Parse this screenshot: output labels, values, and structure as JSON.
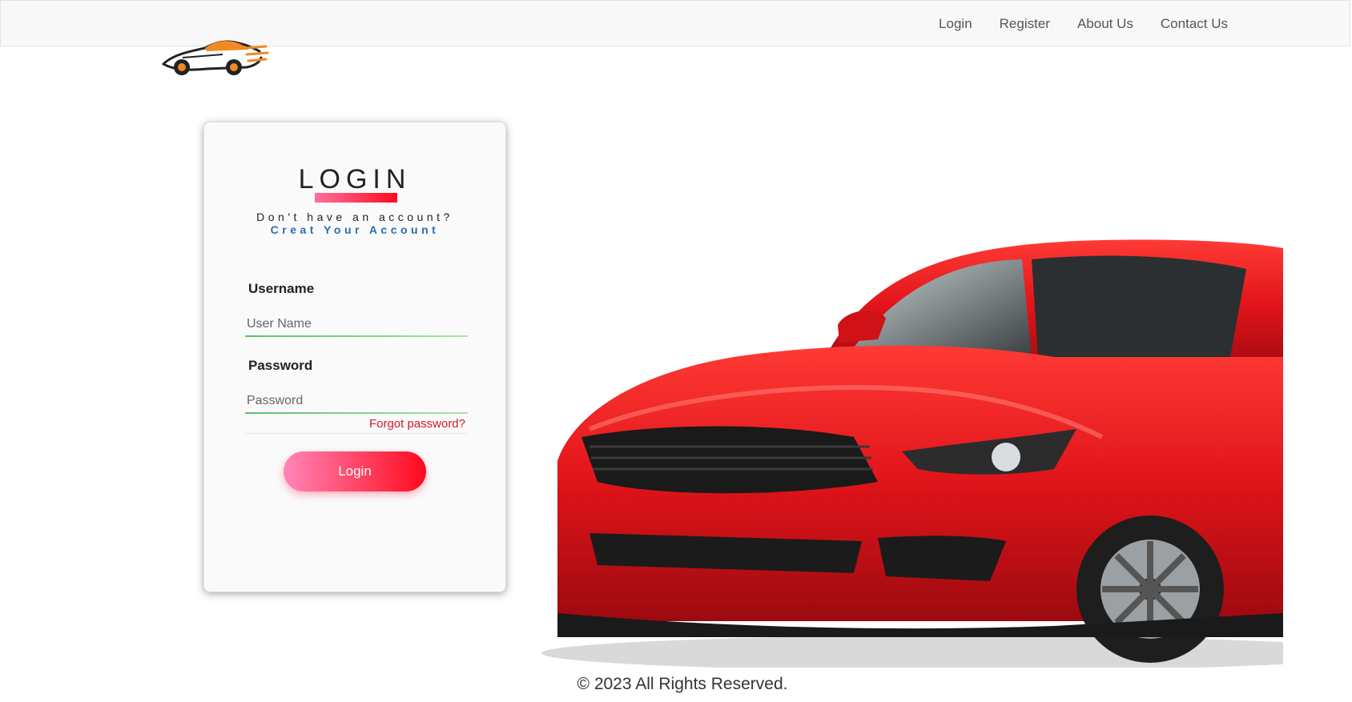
{
  "nav": {
    "items": [
      {
        "label": "Login"
      },
      {
        "label": "Register"
      },
      {
        "label": "About Us"
      },
      {
        "label": "Contact Us"
      }
    ]
  },
  "login": {
    "title": "LOGIN",
    "no_account_text": "Don't have an account?",
    "create_account_link": "Creat Your Account",
    "username_label": "Username",
    "username_placeholder": "User Name",
    "password_label": "Password",
    "password_placeholder": "Password",
    "forgot_password": "Forgot password?",
    "submit_label": "Login"
  },
  "footer": {
    "copyright": "© 2023 All Rights Reserved."
  },
  "colors": {
    "accent_start": "#ff86b8",
    "accent_end": "#ff0a1c",
    "link_blue": "#2a6db0",
    "input_underline": "#5cc06a",
    "car_red": "#e0141a"
  },
  "icons": {
    "logo": "sports-car-logo",
    "hero": "red-car-image"
  }
}
